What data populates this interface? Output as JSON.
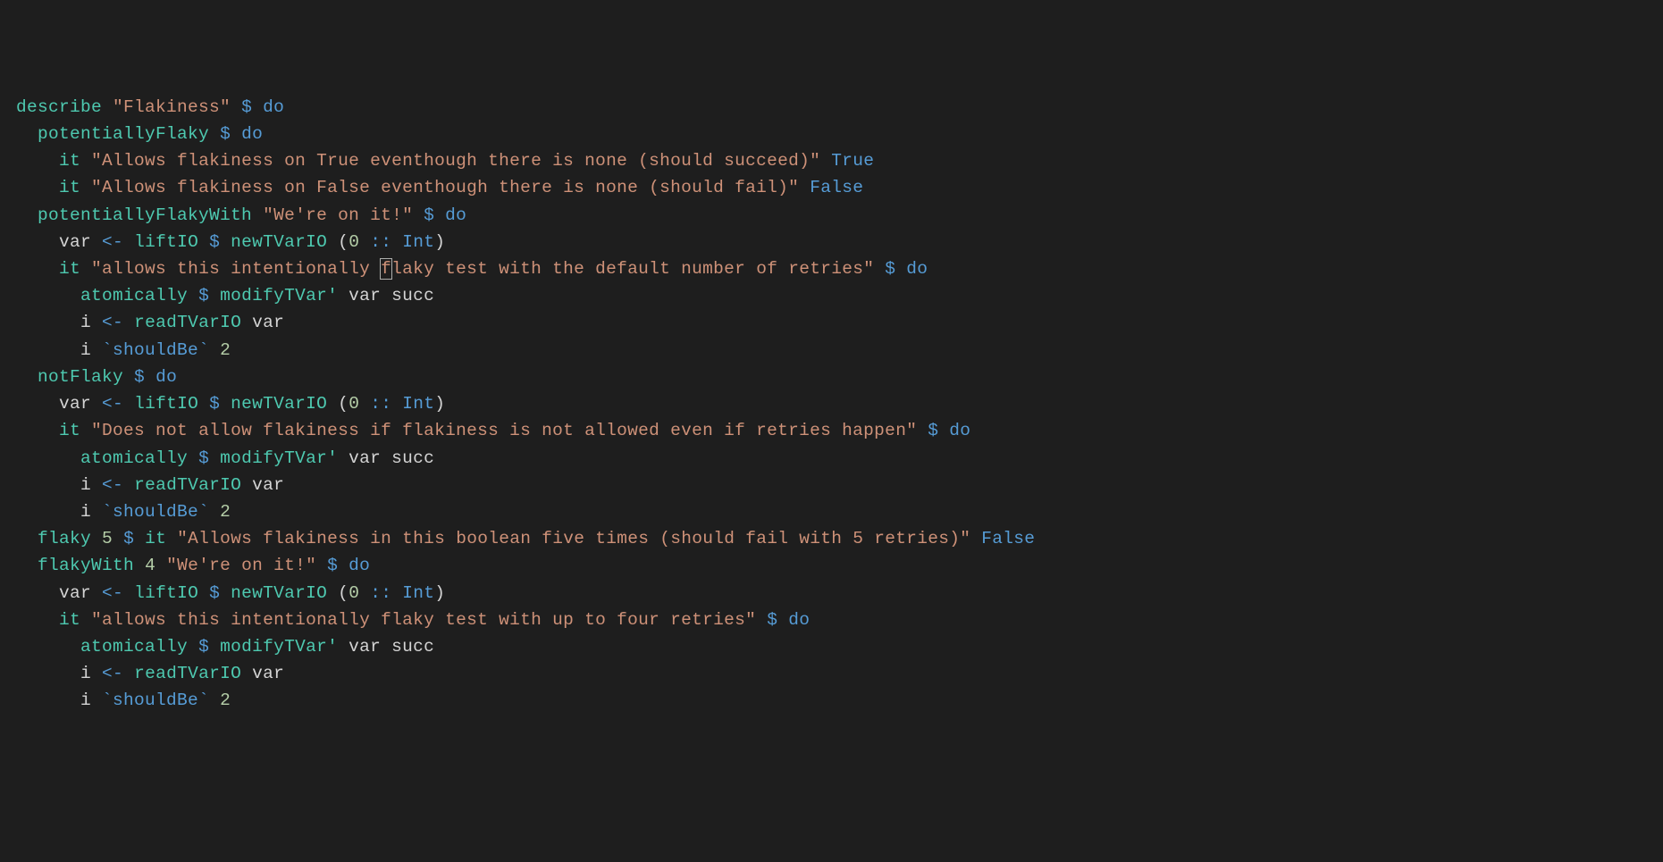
{
  "tokens": [
    {
      "t": "describe",
      "c": "c-fn"
    },
    {
      "t": " ",
      "c": "c-ident"
    },
    {
      "t": "\"Flakiness\"",
      "c": "c-str"
    },
    {
      "t": " ",
      "c": "c-ident"
    },
    {
      "t": "$",
      "c": "c-op"
    },
    {
      "t": " ",
      "c": "c-ident"
    },
    {
      "t": "do",
      "c": "c-op"
    },
    {
      "t": "\n",
      "c": "c-ident"
    },
    {
      "t": "  ",
      "c": "c-ident"
    },
    {
      "t": "potentiallyFlaky",
      "c": "c-fn"
    },
    {
      "t": " ",
      "c": "c-ident"
    },
    {
      "t": "$",
      "c": "c-op"
    },
    {
      "t": " ",
      "c": "c-ident"
    },
    {
      "t": "do",
      "c": "c-op"
    },
    {
      "t": "\n",
      "c": "c-ident"
    },
    {
      "t": "    ",
      "c": "c-ident"
    },
    {
      "t": "it",
      "c": "c-fn"
    },
    {
      "t": " ",
      "c": "c-ident"
    },
    {
      "t": "\"Allows flakiness on True eventhough there is none (should succeed)\"",
      "c": "c-str"
    },
    {
      "t": " ",
      "c": "c-ident"
    },
    {
      "t": "True",
      "c": "c-const"
    },
    {
      "t": "\n",
      "c": "c-ident"
    },
    {
      "t": "    ",
      "c": "c-ident"
    },
    {
      "t": "it",
      "c": "c-fn"
    },
    {
      "t": " ",
      "c": "c-ident"
    },
    {
      "t": "\"Allows flakiness on False eventhough there is none (should fail)\"",
      "c": "c-str"
    },
    {
      "t": " ",
      "c": "c-ident"
    },
    {
      "t": "False",
      "c": "c-const"
    },
    {
      "t": "\n",
      "c": "c-ident"
    },
    {
      "t": "  ",
      "c": "c-ident"
    },
    {
      "t": "potentiallyFlakyWith",
      "c": "c-fn"
    },
    {
      "t": " ",
      "c": "c-ident"
    },
    {
      "t": "\"We're on it!\"",
      "c": "c-str"
    },
    {
      "t": " ",
      "c": "c-ident"
    },
    {
      "t": "$",
      "c": "c-op"
    },
    {
      "t": " ",
      "c": "c-ident"
    },
    {
      "t": "do",
      "c": "c-op"
    },
    {
      "t": "\n",
      "c": "c-ident"
    },
    {
      "t": "    ",
      "c": "c-ident"
    },
    {
      "t": "var",
      "c": "c-ident"
    },
    {
      "t": " ",
      "c": "c-ident"
    },
    {
      "t": "<-",
      "c": "c-op"
    },
    {
      "t": " ",
      "c": "c-ident"
    },
    {
      "t": "liftIO",
      "c": "c-fn"
    },
    {
      "t": " ",
      "c": "c-ident"
    },
    {
      "t": "$",
      "c": "c-op"
    },
    {
      "t": " ",
      "c": "c-ident"
    },
    {
      "t": "newTVarIO",
      "c": "c-fn"
    },
    {
      "t": " (",
      "c": "c-ident"
    },
    {
      "t": "0",
      "c": "c-num"
    },
    {
      "t": " ",
      "c": "c-ident"
    },
    {
      "t": "::",
      "c": "c-op"
    },
    {
      "t": " ",
      "c": "c-ident"
    },
    {
      "t": "Int",
      "c": "c-const"
    },
    {
      "t": ")",
      "c": "c-ident"
    },
    {
      "t": "\n",
      "c": "c-ident"
    },
    {
      "t": "    ",
      "c": "c-ident"
    },
    {
      "t": "it",
      "c": "c-fn"
    },
    {
      "t": " ",
      "c": "c-ident"
    },
    {
      "t": "\"allows this intentionally ",
      "c": "c-str"
    },
    {
      "t": "f",
      "c": "c-str",
      "cur": true
    },
    {
      "t": "laky test with the default number of retries\"",
      "c": "c-str"
    },
    {
      "t": " ",
      "c": "c-ident"
    },
    {
      "t": "$",
      "c": "c-op"
    },
    {
      "t": " ",
      "c": "c-ident"
    },
    {
      "t": "do",
      "c": "c-op"
    },
    {
      "t": "\n",
      "c": "c-ident"
    },
    {
      "t": "      ",
      "c": "c-ident"
    },
    {
      "t": "atomically",
      "c": "c-fn"
    },
    {
      "t": " ",
      "c": "c-ident"
    },
    {
      "t": "$",
      "c": "c-op"
    },
    {
      "t": " ",
      "c": "c-ident"
    },
    {
      "t": "modifyTVar'",
      "c": "c-fn"
    },
    {
      "t": " var succ",
      "c": "c-ident"
    },
    {
      "t": "\n",
      "c": "c-ident"
    },
    {
      "t": "      ",
      "c": "c-ident"
    },
    {
      "t": "i",
      "c": "c-ident"
    },
    {
      "t": " ",
      "c": "c-ident"
    },
    {
      "t": "<-",
      "c": "c-op"
    },
    {
      "t": " ",
      "c": "c-ident"
    },
    {
      "t": "readTVarIO",
      "c": "c-fn"
    },
    {
      "t": " var",
      "c": "c-ident"
    },
    {
      "t": "\n",
      "c": "c-ident"
    },
    {
      "t": "      ",
      "c": "c-ident"
    },
    {
      "t": "i",
      "c": "c-ident"
    },
    {
      "t": " ",
      "c": "c-ident"
    },
    {
      "t": "`shouldBe`",
      "c": "c-bt"
    },
    {
      "t": " ",
      "c": "c-ident"
    },
    {
      "t": "2",
      "c": "c-num"
    },
    {
      "t": "\n",
      "c": "c-ident"
    },
    {
      "t": "  ",
      "c": "c-ident"
    },
    {
      "t": "notFlaky",
      "c": "c-fn"
    },
    {
      "t": " ",
      "c": "c-ident"
    },
    {
      "t": "$",
      "c": "c-op"
    },
    {
      "t": " ",
      "c": "c-ident"
    },
    {
      "t": "do",
      "c": "c-op"
    },
    {
      "t": "\n",
      "c": "c-ident"
    },
    {
      "t": "    ",
      "c": "c-ident"
    },
    {
      "t": "var",
      "c": "c-ident"
    },
    {
      "t": " ",
      "c": "c-ident"
    },
    {
      "t": "<-",
      "c": "c-op"
    },
    {
      "t": " ",
      "c": "c-ident"
    },
    {
      "t": "liftIO",
      "c": "c-fn"
    },
    {
      "t": " ",
      "c": "c-ident"
    },
    {
      "t": "$",
      "c": "c-op"
    },
    {
      "t": " ",
      "c": "c-ident"
    },
    {
      "t": "newTVarIO",
      "c": "c-fn"
    },
    {
      "t": " (",
      "c": "c-ident"
    },
    {
      "t": "0",
      "c": "c-num"
    },
    {
      "t": " ",
      "c": "c-ident"
    },
    {
      "t": "::",
      "c": "c-op"
    },
    {
      "t": " ",
      "c": "c-ident"
    },
    {
      "t": "Int",
      "c": "c-const"
    },
    {
      "t": ")",
      "c": "c-ident"
    },
    {
      "t": "\n",
      "c": "c-ident"
    },
    {
      "t": "    ",
      "c": "c-ident"
    },
    {
      "t": "it",
      "c": "c-fn"
    },
    {
      "t": " ",
      "c": "c-ident"
    },
    {
      "t": "\"Does not allow flakiness if flakiness is not allowed even if retries happen\"",
      "c": "c-str"
    },
    {
      "t": " ",
      "c": "c-ident"
    },
    {
      "t": "$",
      "c": "c-op"
    },
    {
      "t": " ",
      "c": "c-ident"
    },
    {
      "t": "do",
      "c": "c-op"
    },
    {
      "t": "\n",
      "c": "c-ident"
    },
    {
      "t": "      ",
      "c": "c-ident"
    },
    {
      "t": "atomically",
      "c": "c-fn"
    },
    {
      "t": " ",
      "c": "c-ident"
    },
    {
      "t": "$",
      "c": "c-op"
    },
    {
      "t": " ",
      "c": "c-ident"
    },
    {
      "t": "modifyTVar'",
      "c": "c-fn"
    },
    {
      "t": " var succ",
      "c": "c-ident"
    },
    {
      "t": "\n",
      "c": "c-ident"
    },
    {
      "t": "      ",
      "c": "c-ident"
    },
    {
      "t": "i",
      "c": "c-ident"
    },
    {
      "t": " ",
      "c": "c-ident"
    },
    {
      "t": "<-",
      "c": "c-op"
    },
    {
      "t": " ",
      "c": "c-ident"
    },
    {
      "t": "readTVarIO",
      "c": "c-fn"
    },
    {
      "t": " var",
      "c": "c-ident"
    },
    {
      "t": "\n",
      "c": "c-ident"
    },
    {
      "t": "      ",
      "c": "c-ident"
    },
    {
      "t": "i",
      "c": "c-ident"
    },
    {
      "t": " ",
      "c": "c-ident"
    },
    {
      "t": "`shouldBe`",
      "c": "c-bt"
    },
    {
      "t": " ",
      "c": "c-ident"
    },
    {
      "t": "2",
      "c": "c-num"
    },
    {
      "t": "\n",
      "c": "c-ident"
    },
    {
      "t": "  ",
      "c": "c-ident"
    },
    {
      "t": "flaky",
      "c": "c-fn"
    },
    {
      "t": " ",
      "c": "c-ident"
    },
    {
      "t": "5",
      "c": "c-num"
    },
    {
      "t": " ",
      "c": "c-ident"
    },
    {
      "t": "$",
      "c": "c-op"
    },
    {
      "t": " ",
      "c": "c-ident"
    },
    {
      "t": "it",
      "c": "c-fn"
    },
    {
      "t": " ",
      "c": "c-ident"
    },
    {
      "t": "\"Allows flakiness in this boolean five times (should fail with 5 retries)\"",
      "c": "c-str"
    },
    {
      "t": " ",
      "c": "c-ident"
    },
    {
      "t": "False",
      "c": "c-const"
    },
    {
      "t": "\n",
      "c": "c-ident"
    },
    {
      "t": "  ",
      "c": "c-ident"
    },
    {
      "t": "flakyWith",
      "c": "c-fn"
    },
    {
      "t": " ",
      "c": "c-ident"
    },
    {
      "t": "4",
      "c": "c-num"
    },
    {
      "t": " ",
      "c": "c-ident"
    },
    {
      "t": "\"We're on it!\"",
      "c": "c-str"
    },
    {
      "t": " ",
      "c": "c-ident"
    },
    {
      "t": "$",
      "c": "c-op"
    },
    {
      "t": " ",
      "c": "c-ident"
    },
    {
      "t": "do",
      "c": "c-op"
    },
    {
      "t": "\n",
      "c": "c-ident"
    },
    {
      "t": "    ",
      "c": "c-ident"
    },
    {
      "t": "var",
      "c": "c-ident"
    },
    {
      "t": " ",
      "c": "c-ident"
    },
    {
      "t": "<-",
      "c": "c-op"
    },
    {
      "t": " ",
      "c": "c-ident"
    },
    {
      "t": "liftIO",
      "c": "c-fn"
    },
    {
      "t": " ",
      "c": "c-ident"
    },
    {
      "t": "$",
      "c": "c-op"
    },
    {
      "t": " ",
      "c": "c-ident"
    },
    {
      "t": "newTVarIO",
      "c": "c-fn"
    },
    {
      "t": " (",
      "c": "c-ident"
    },
    {
      "t": "0",
      "c": "c-num"
    },
    {
      "t": " ",
      "c": "c-ident"
    },
    {
      "t": "::",
      "c": "c-op"
    },
    {
      "t": " ",
      "c": "c-ident"
    },
    {
      "t": "Int",
      "c": "c-const"
    },
    {
      "t": ")",
      "c": "c-ident"
    },
    {
      "t": "\n",
      "c": "c-ident"
    },
    {
      "t": "    ",
      "c": "c-ident"
    },
    {
      "t": "it",
      "c": "c-fn"
    },
    {
      "t": " ",
      "c": "c-ident"
    },
    {
      "t": "\"allows this intentionally flaky test with up to four retries\"",
      "c": "c-str"
    },
    {
      "t": " ",
      "c": "c-ident"
    },
    {
      "t": "$",
      "c": "c-op"
    },
    {
      "t": " ",
      "c": "c-ident"
    },
    {
      "t": "do",
      "c": "c-op"
    },
    {
      "t": "\n",
      "c": "c-ident"
    },
    {
      "t": "      ",
      "c": "c-ident"
    },
    {
      "t": "atomically",
      "c": "c-fn"
    },
    {
      "t": " ",
      "c": "c-ident"
    },
    {
      "t": "$",
      "c": "c-op"
    },
    {
      "t": " ",
      "c": "c-ident"
    },
    {
      "t": "modifyTVar'",
      "c": "c-fn"
    },
    {
      "t": " var succ",
      "c": "c-ident"
    },
    {
      "t": "\n",
      "c": "c-ident"
    },
    {
      "t": "      ",
      "c": "c-ident"
    },
    {
      "t": "i",
      "c": "c-ident"
    },
    {
      "t": " ",
      "c": "c-ident"
    },
    {
      "t": "<-",
      "c": "c-op"
    },
    {
      "t": " ",
      "c": "c-ident"
    },
    {
      "t": "readTVarIO",
      "c": "c-fn"
    },
    {
      "t": " var",
      "c": "c-ident"
    },
    {
      "t": "\n",
      "c": "c-ident"
    },
    {
      "t": "      ",
      "c": "c-ident"
    },
    {
      "t": "i",
      "c": "c-ident"
    },
    {
      "t": " ",
      "c": "c-ident"
    },
    {
      "t": "`shouldBe`",
      "c": "c-bt"
    },
    {
      "t": " ",
      "c": "c-ident"
    },
    {
      "t": "2",
      "c": "c-num"
    }
  ]
}
